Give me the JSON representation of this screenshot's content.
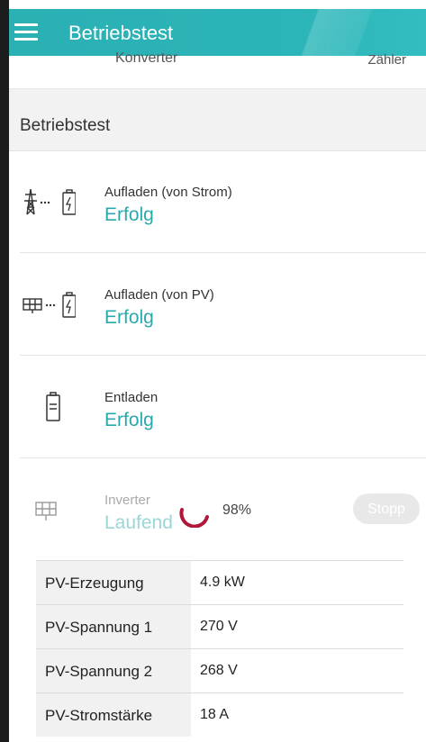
{
  "header": {
    "title": "Betriebstest"
  },
  "top_strip": {
    "left": "Konverter",
    "right": "Zähler"
  },
  "section": {
    "title": "Betriebstest"
  },
  "tests": [
    {
      "label": "Aufladen (von Strom)",
      "status": "Erfolg",
      "icon": "grid-to-battery-icon"
    },
    {
      "label": "Aufladen (von PV)",
      "status": "Erfolg",
      "icon": "pv-to-battery-icon"
    },
    {
      "label": "Entladen",
      "status": "Erfolg",
      "icon": "battery-icon"
    },
    {
      "label": "Inverter",
      "status": "Laufend",
      "icon": "pv-panel-icon",
      "progress_percent": "98%",
      "stop_label": "Stopp"
    }
  ],
  "measurements": [
    {
      "key": "PV-Erzeugung",
      "value": "4.9 kW"
    },
    {
      "key": "PV-Spannung 1",
      "value": "270 V"
    },
    {
      "key": "PV-Spannung 2",
      "value": "268 V"
    },
    {
      "key": "PV-Stromstärke",
      "value": "18 A"
    }
  ],
  "colors": {
    "accent": "#2aa9ad",
    "spinner": "#b0173a",
    "header": "#2bb0b4"
  }
}
